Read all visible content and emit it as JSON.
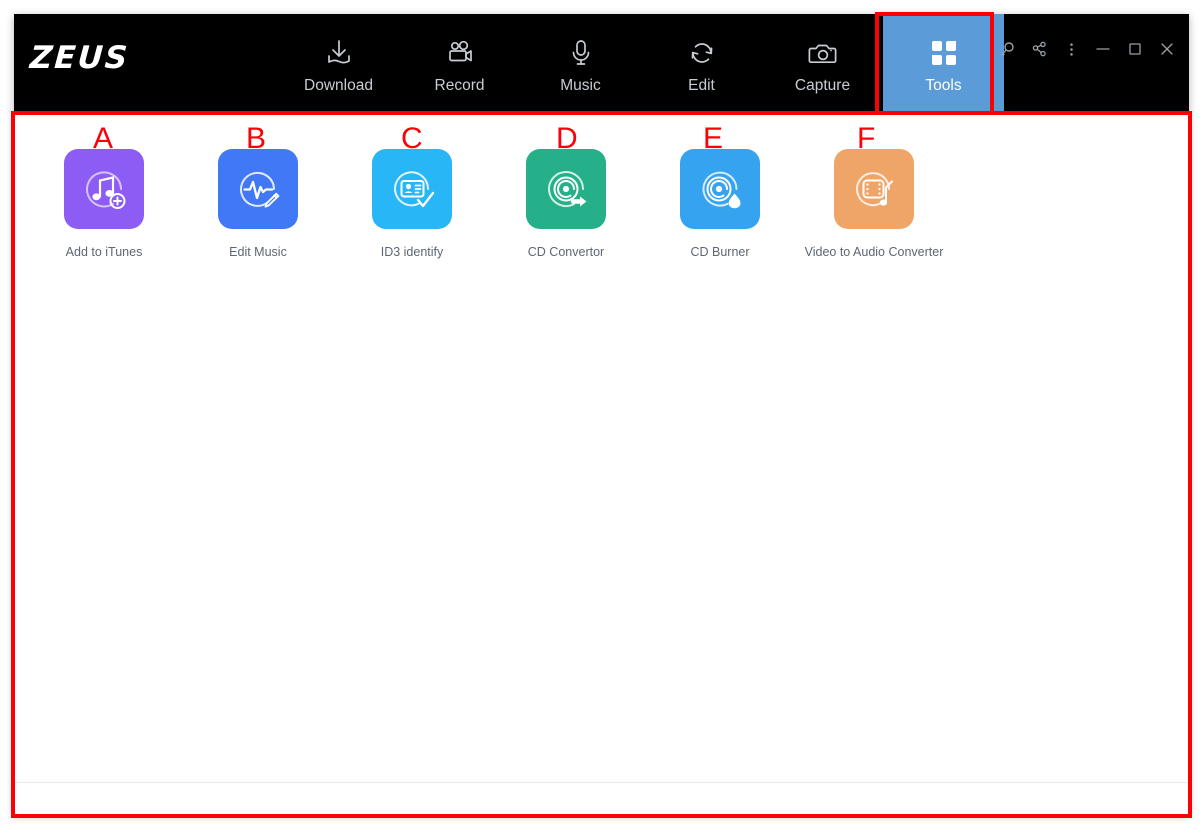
{
  "window": {
    "logo": "ZEUS",
    "controls": [
      {
        "name": "search-icon",
        "label": "Search"
      },
      {
        "name": "share-icon",
        "label": "Share"
      },
      {
        "name": "more-options-icon",
        "label": "More"
      },
      {
        "name": "minimize-icon",
        "label": "Minimize"
      },
      {
        "name": "maximize-icon",
        "label": "Maximize"
      },
      {
        "name": "close-icon",
        "label": "Close"
      }
    ]
  },
  "nav": {
    "active": "Tools",
    "active_color": "#5b9bd8",
    "items": [
      {
        "label": "Download",
        "icon": "download-icon",
        "active": false
      },
      {
        "label": "Record",
        "icon": "video-camera-icon",
        "active": false
      },
      {
        "label": "Music",
        "icon": "microphone-icon",
        "active": false
      },
      {
        "label": "Edit",
        "icon": "refresh-arrows-icon",
        "active": false
      },
      {
        "label": "Capture",
        "icon": "camera-icon",
        "active": false
      },
      {
        "label": "Tools",
        "icon": "grid-squares-icon",
        "active": true
      }
    ]
  },
  "tools": [
    {
      "label": "Add to iTunes",
      "icon": "music-note-plus-icon",
      "color": "#8c5cf5",
      "marker": "A"
    },
    {
      "label": "Edit Music",
      "icon": "waveform-pencil-icon",
      "color": "#4178f5",
      "marker": "B"
    },
    {
      "label": "ID3 identify",
      "icon": "id-card-check-icon",
      "color": "#29b6f6",
      "marker": "C"
    },
    {
      "label": "CD Convertor",
      "icon": "disc-arrow-icon",
      "color": "#26b08a",
      "marker": "D"
    },
    {
      "label": "CD Burner",
      "icon": "disc-flame-icon",
      "color": "#35a3f0",
      "marker": "E"
    },
    {
      "label": "Video to Audio Converter",
      "icon": "film-music-note-icon",
      "color": "#f0a568",
      "marker": "F"
    }
  ],
  "annotations": {
    "color": "#fb0007",
    "letters": [
      "A",
      "B",
      "C",
      "D",
      "E",
      "F"
    ],
    "regions": [
      "tools-panel-outline",
      "tools-tab-outline"
    ]
  }
}
